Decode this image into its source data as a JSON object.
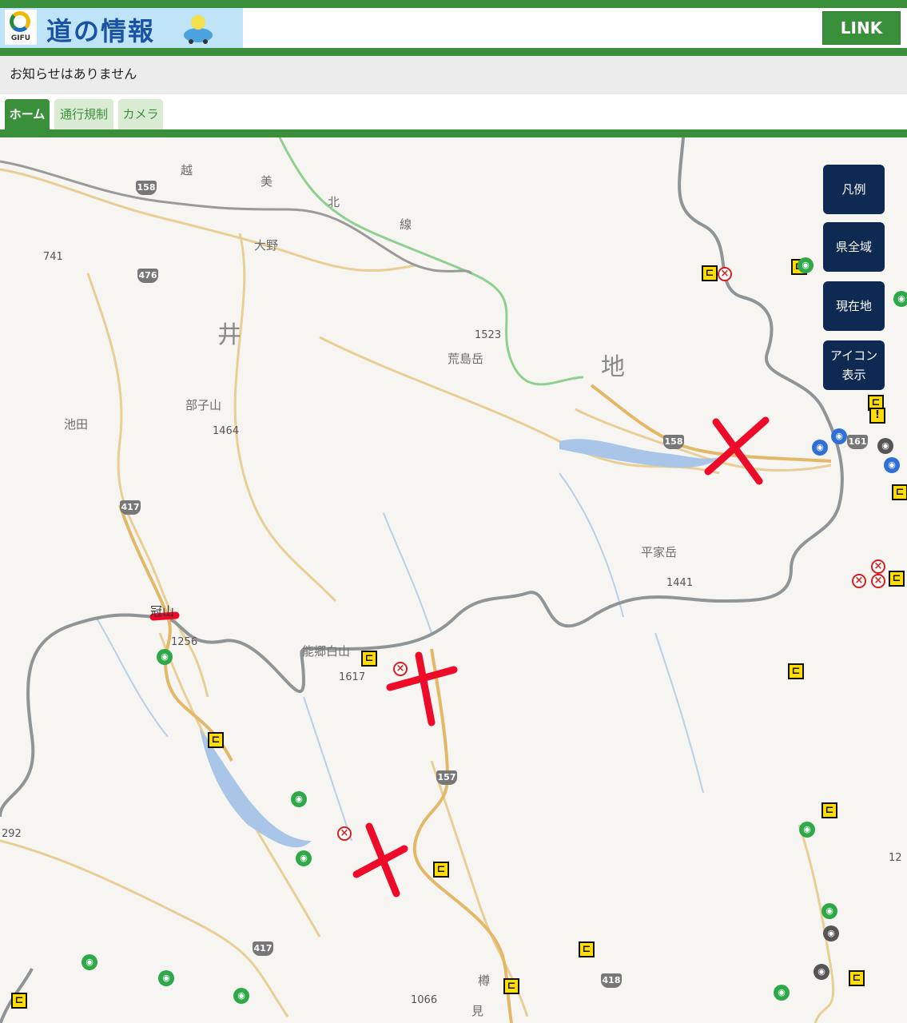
{
  "header": {
    "logo_text": "GIFU",
    "title": "道の情報",
    "link_label": "LINK"
  },
  "notice": "お知らせはありません",
  "tabs": [
    {
      "label": "ホーム",
      "active": true
    },
    {
      "label": "通行規制",
      "active": false
    },
    {
      "label": "カメラ",
      "active": false
    }
  ],
  "side_buttons": [
    "凡例",
    "県全域",
    "現在地",
    "アイコン表示"
  ],
  "map_labels": {
    "etsu": "越",
    "mi": "美",
    "kita": "北",
    "sen": "線",
    "ono": "大野",
    "fukui": "井",
    "chi": "地",
    "arashimadake": "荒島岳",
    "h1523": "1523",
    "h741": "741",
    "bukosan": "部子山",
    "h1464": "1464",
    "ikeda": "池田",
    "heikegatake": "平家岳",
    "h1441": "1441",
    "kanmuriyama": "冠山",
    "h1256": "1256",
    "nogohakusan": "能郷白山",
    "h1617": "1617",
    "h292": "292",
    "h1066": "1066",
    "h12": "12",
    "neo": "樽",
    "mi2": "見"
  },
  "route_numbers": [
    "158",
    "476",
    "158",
    "417",
    "157",
    "417",
    "418",
    "161"
  ],
  "colors": {
    "brand_green": "#3a8f3a",
    "button_navy": "#0e2a52",
    "closure_red": "#d62020",
    "sign_yellow": "#ffdd00"
  }
}
